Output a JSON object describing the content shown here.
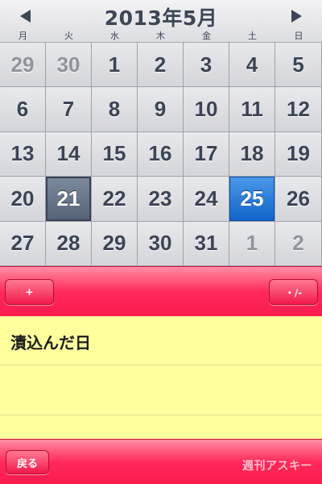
{
  "calendar": {
    "title": "2013年5月",
    "weekdays": [
      "月",
      "火",
      "水",
      "木",
      "金",
      "土",
      "日"
    ],
    "weeks": [
      [
        "29",
        "30",
        "1",
        "2",
        "3",
        "4",
        "5"
      ],
      [
        "6",
        "7",
        "8",
        "9",
        "10",
        "11",
        "12"
      ],
      [
        "13",
        "14",
        "15",
        "16",
        "17",
        "18",
        "19"
      ],
      [
        "20",
        "21",
        "22",
        "23",
        "24",
        "25",
        "26"
      ],
      [
        "27",
        "28",
        "29",
        "30",
        "31",
        "1",
        "2"
      ]
    ],
    "today": "21",
    "selected": "25",
    "colors": {
      "selected": "#1263c8",
      "today": "#556177"
    }
  },
  "toolbar": {
    "add_label": "+",
    "dot_label": "・/-",
    "back_label": "戻る"
  },
  "note": {
    "text": "漬込んだ日"
  },
  "watermark": "週刊アスキー",
  "theme": {
    "toolbar": "#ff2a5a",
    "note_background": "#ffff9e"
  }
}
